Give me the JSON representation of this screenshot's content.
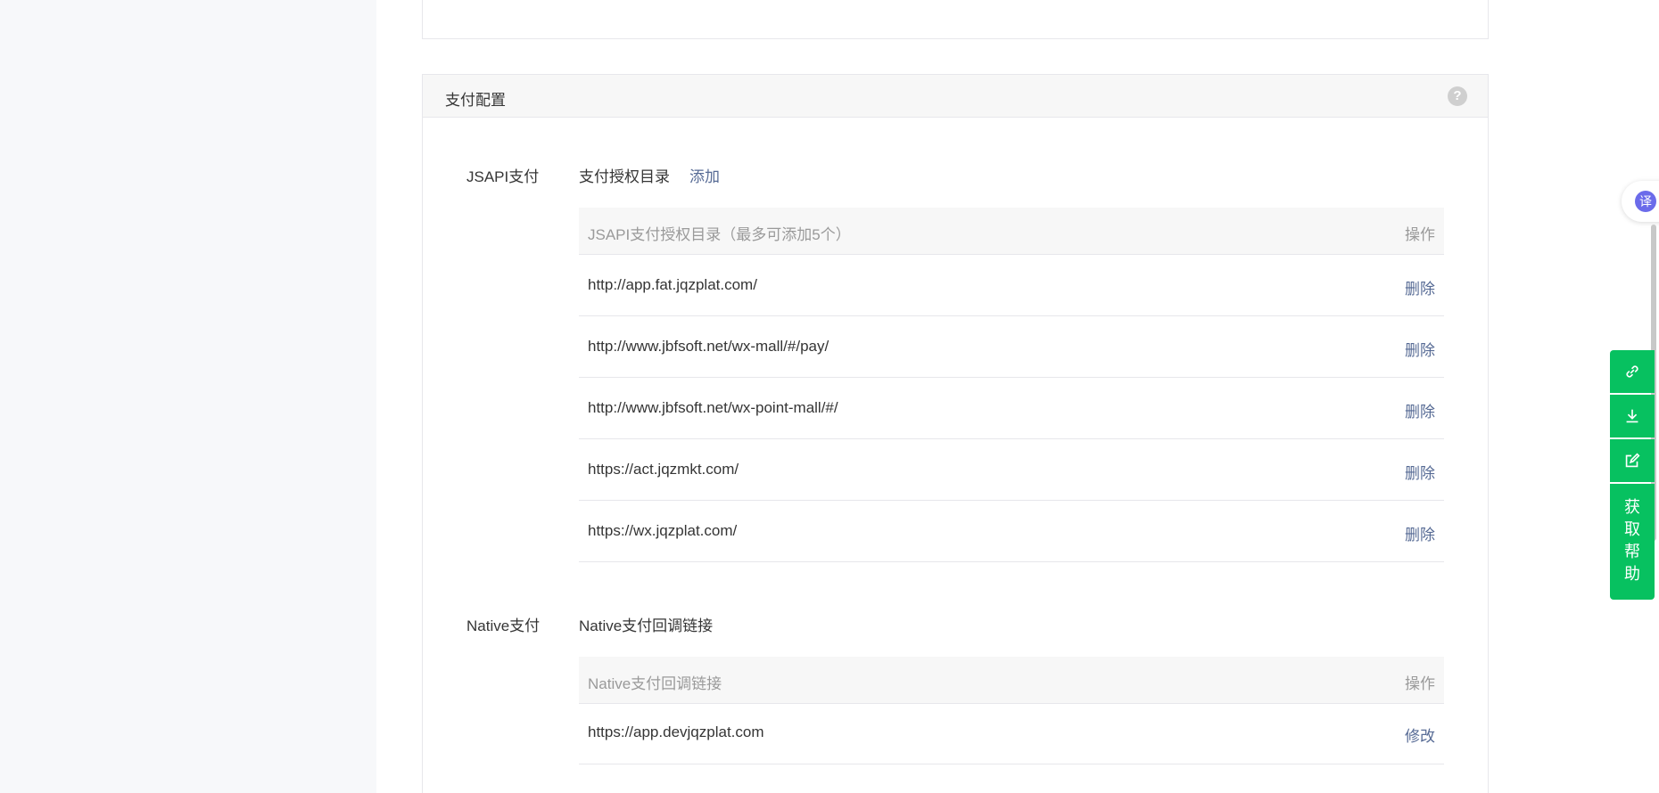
{
  "card": {
    "title": "支付配置"
  },
  "jsapi": {
    "label": "JSAPI支付",
    "subtitle": "支付授权目录",
    "add_label": "添加",
    "table": {
      "header_left": "JSAPI支付授权目录（最多可添加5个）",
      "header_right": "操作",
      "rows": [
        {
          "url": "http://app.fat.jqzplat.com/",
          "action": "删除"
        },
        {
          "url": "http://www.jbfsoft.net/wx-mall/#/pay/",
          "action": "删除"
        },
        {
          "url": "http://www.jbfsoft.net/wx-point-mall/#/",
          "action": "删除"
        },
        {
          "url": "https://act.jqzmkt.com/",
          "action": "删除"
        },
        {
          "url": "https://wx.jqzplat.com/",
          "action": "删除"
        }
      ]
    }
  },
  "native": {
    "label": "Native支付",
    "subtitle": "Native支付回调链接",
    "table": {
      "header_left": "Native支付回调链接",
      "header_right": "操作",
      "rows": [
        {
          "url": "https://app.devjqzplat.com",
          "action": "修改"
        }
      ]
    }
  },
  "widgets": {
    "translate_glyph": "译",
    "help_chars": [
      "获",
      "取",
      "帮",
      "助"
    ],
    "icons": [
      "link-icon",
      "download-icon",
      "edit-icon"
    ],
    "accent_color": "#07c160",
    "link_color": "#576b95"
  }
}
